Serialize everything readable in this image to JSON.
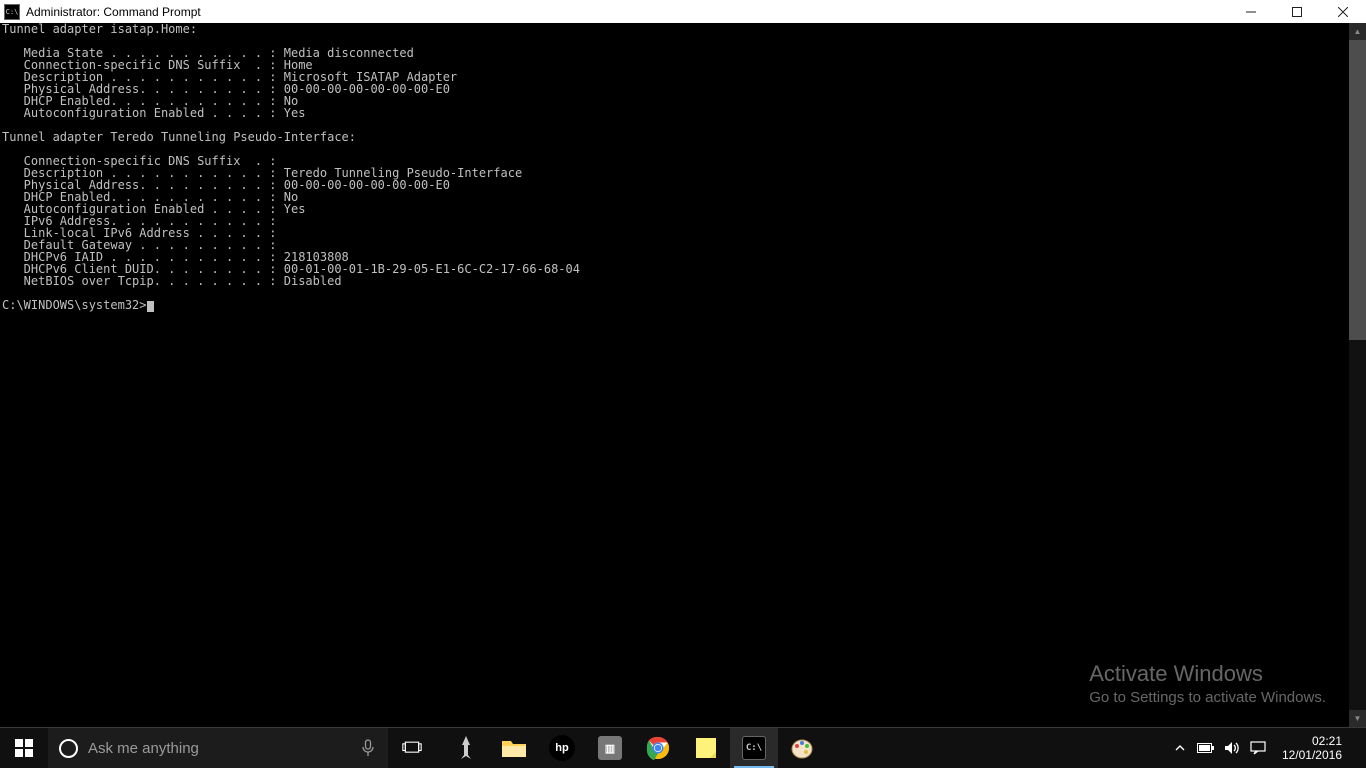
{
  "window": {
    "title": "Administrator: Command Prompt",
    "cmd_icon_label": "C:\\"
  },
  "terminal": {
    "lines": [
      "Tunnel adapter isatap.Home:",
      "",
      "   Media State . . . . . . . . . . . : Media disconnected",
      "   Connection-specific DNS Suffix  . : Home",
      "   Description . . . . . . . . . . . : Microsoft ISATAP Adapter",
      "   Physical Address. . . . . . . . . : 00-00-00-00-00-00-00-E0",
      "   DHCP Enabled. . . . . . . . . . . : No",
      "   Autoconfiguration Enabled . . . . : Yes",
      "",
      "Tunnel adapter Teredo Tunneling Pseudo-Interface:",
      "",
      "   Connection-specific DNS Suffix  . :",
      "   Description . . . . . . . . . . . : Teredo Tunneling Pseudo-Interface",
      "   Physical Address. . . . . . . . . : 00-00-00-00-00-00-00-E0",
      "   DHCP Enabled. . . . . . . . . . . : No",
      "   Autoconfiguration Enabled . . . . : Yes",
      "   IPv6 Address. . . . . . . . . . . :",
      "   Link-local IPv6 Address . . . . . :",
      "   Default Gateway . . . . . . . . . :",
      "   DHCPv6 IAID . . . . . . . . . . . : 218103808",
      "   DHCPv6 Client DUID. . . . . . . . : 00-01-00-01-1B-29-05-E1-6C-C2-17-66-68-04",
      "   NetBIOS over Tcpip. . . . . . . . : Disabled",
      ""
    ],
    "prompt": "C:\\WINDOWS\\system32>"
  },
  "watermark": {
    "title": "Activate Windows",
    "subtitle": "Go to Settings to activate Windows."
  },
  "taskbar": {
    "search_placeholder": "Ask me anything",
    "clock_time": "02:21",
    "clock_date": "12/01/2016"
  }
}
